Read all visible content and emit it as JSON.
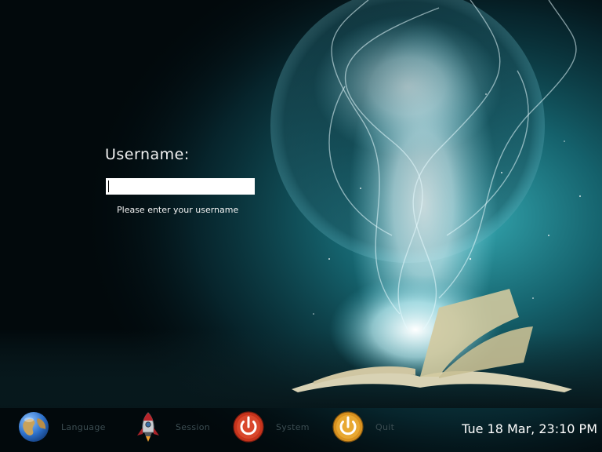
{
  "login": {
    "username_label": "Username:",
    "username_value": "",
    "hint": "Please enter your username"
  },
  "bottom_bar": {
    "language_label": "Language",
    "session_label": "Session",
    "system_label": "System",
    "quit_label": "Quit",
    "icons": [
      "globe-icon",
      "rocket-icon",
      "power-icon",
      "power-icon"
    ]
  },
  "clock": {
    "text": "Tue 18 Mar, 23:10 PM"
  },
  "colors": {
    "background": "#02090c",
    "teal_glow": "#2fb8c4",
    "system_red": "#c7341c",
    "quit_orange": "#d9921f",
    "bar_label": "#3c4d52"
  }
}
